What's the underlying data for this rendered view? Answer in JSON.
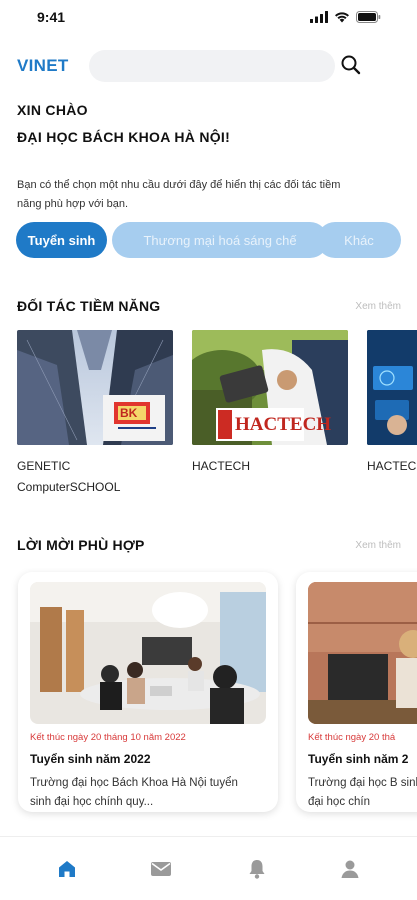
{
  "status_bar": {
    "time": "9:41"
  },
  "header": {
    "brand": "VINET",
    "search_value": ""
  },
  "greeting": {
    "line1": "XIN CHÀO",
    "line2": "ĐẠI HỌC BÁCH KHOA HÀ NỘI!"
  },
  "intro": "Bạn có thể chọn một nhu cầu dưới đây để hiển thị các đối tác tiềm năng phù hợp với bạn.",
  "chips": [
    {
      "label": "Tuyển sinh",
      "active": true
    },
    {
      "label": "Thương mại hoá sáng chế",
      "active": false
    },
    {
      "label": "Khác",
      "active": false
    }
  ],
  "partners_section": {
    "title": "ĐỐI TÁC TIỀM NĂNG",
    "see_more": "Xem thêm",
    "items": [
      {
        "name": "GENETIC\nComputerSCHOOL",
        "logo_text": "BK"
      },
      {
        "name": "HACTECH",
        "logo_text": "HACTECH"
      },
      {
        "name": "HACTECH"
      }
    ]
  },
  "offers_section": {
    "title": "LỜI MỜI PHÙ HỢP",
    "see_more": "Xem thêm",
    "items": [
      {
        "end_date": "Kết thúc ngày 20 tháng 10 năm 2022",
        "title": "Tuyển sinh năm 2022",
        "desc": "Trường đại học Bách Khoa Hà Nội tuyển sinh đại học chính quy..."
      },
      {
        "end_date": "Kết thúc ngày 20 thá",
        "title": "Tuyển sinh năm 2",
        "desc": "Trường đại học B sinh đại học chín"
      }
    ]
  },
  "tabbar": [
    {
      "icon": "home-icon",
      "active": true
    },
    {
      "icon": "mail-icon",
      "active": false
    },
    {
      "icon": "bell-icon",
      "active": false
    },
    {
      "icon": "user-icon",
      "active": false
    }
  ],
  "colors": {
    "accent": "#1f7ac7",
    "chip_inactive": "#a6cdef",
    "date_red": "#d83a3a",
    "see_more": "#bdbdbd",
    "icon_gray": "#9a9a9a"
  }
}
